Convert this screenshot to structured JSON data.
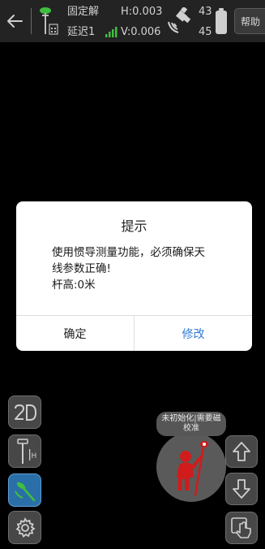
{
  "status_bar": {
    "solution": "固定解",
    "delay": "延迟1",
    "h_precision": "H:0.003",
    "v_precision": "V:0.006",
    "sats_top": "43",
    "sats_bottom": "45",
    "help_label": "帮助"
  },
  "dialog": {
    "title": "提示",
    "message_lines": [
      "使用惯导测量功能，必须确保天",
      "线参数正确!",
      "杆高:0米"
    ],
    "confirm_label": "确定",
    "modify_label": "修改"
  },
  "imu": {
    "status_line1": "未初始化|需要磁",
    "status_line2": "校准"
  },
  "tools": {
    "view_2d_label": "2D"
  },
  "colors": {
    "accent_blue": "#2f7bd6",
    "figure_red": "#d01c1c",
    "tilt_button_blue": "#2b6fa8"
  }
}
